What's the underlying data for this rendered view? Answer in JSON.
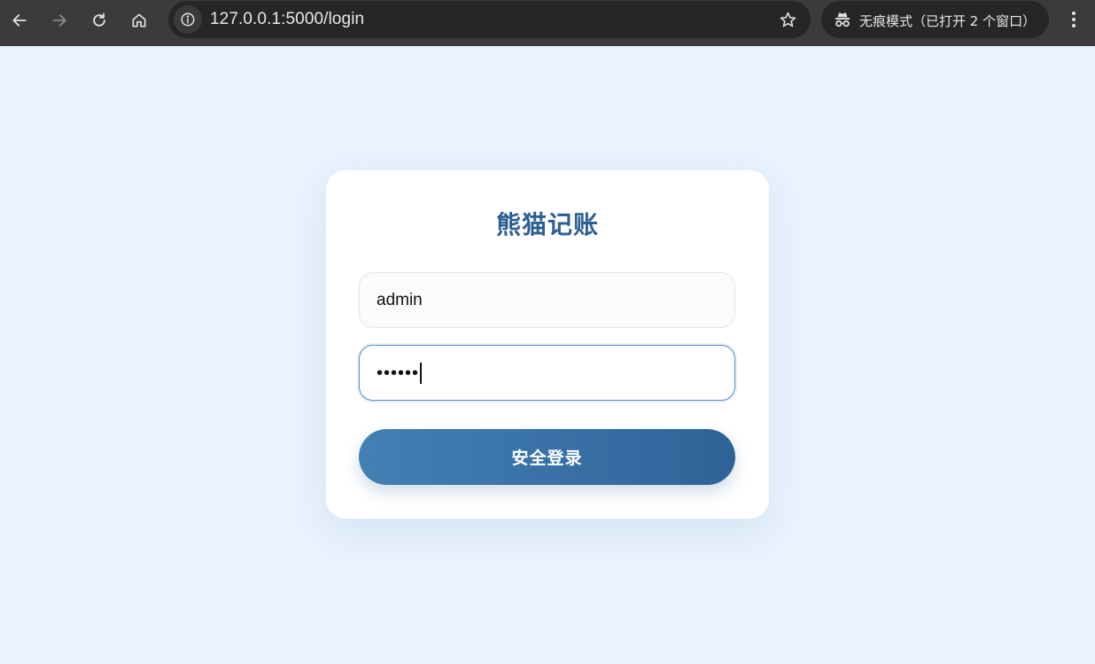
{
  "browser": {
    "url": "127.0.0.1:5000/login",
    "incognito_label": "无痕模式（已打开 2 个窗口）",
    "icons": {
      "back": "arrow-left-icon",
      "forward": "arrow-right-icon",
      "reload": "reload-icon",
      "home": "home-icon",
      "site_info": "info-icon",
      "bookmark": "star-icon",
      "incognito": "incognito-icon",
      "menu": "kebab-menu-icon"
    }
  },
  "login": {
    "title": "熊猫记账",
    "username_value": "admin",
    "password_mask": "••••••",
    "submit_label": "安全登录"
  },
  "colors": {
    "page_background": "#e9f2fd",
    "title": "#2e5f92",
    "button_start": "#4380b4",
    "button_end": "#2f6398",
    "focus_border": "#5a8fc8"
  }
}
